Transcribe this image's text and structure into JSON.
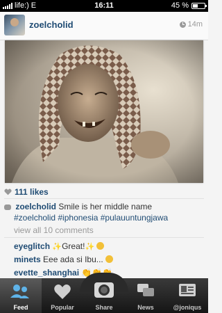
{
  "status_bar": {
    "carrier": "life:)",
    "network": "E",
    "time": "16:11",
    "battery": "45 %",
    "battery_level": 0.45
  },
  "post": {
    "username": "zoelcholid",
    "time_ago": "14m",
    "likes": "111 likes",
    "caption_user": "zoelcholid",
    "caption_line1": "Smile is her middle name",
    "caption_line2": "#zoelcholid #iphonesia #pulauuntungjawa",
    "view_all": "view all 10 comments",
    "comments": [
      {
        "user": "eyeglitch",
        "text": "Great!"
      },
      {
        "user": "minets",
        "text": "Eee ada si Ibu..."
      },
      {
        "user": "evette_shanghai",
        "text": ""
      }
    ]
  },
  "tabs": [
    {
      "label": "Feed",
      "icon": "feed-icon"
    },
    {
      "label": "Popular",
      "icon": "heart-icon"
    },
    {
      "label": "Share",
      "icon": "camera-icon"
    },
    {
      "label": "News",
      "icon": "news-icon"
    },
    {
      "label": "@joniqus",
      "icon": "profile-icon"
    }
  ],
  "colors": {
    "username_blue": "#1f4b73",
    "active_tab_icon": "#5fb3e8"
  }
}
